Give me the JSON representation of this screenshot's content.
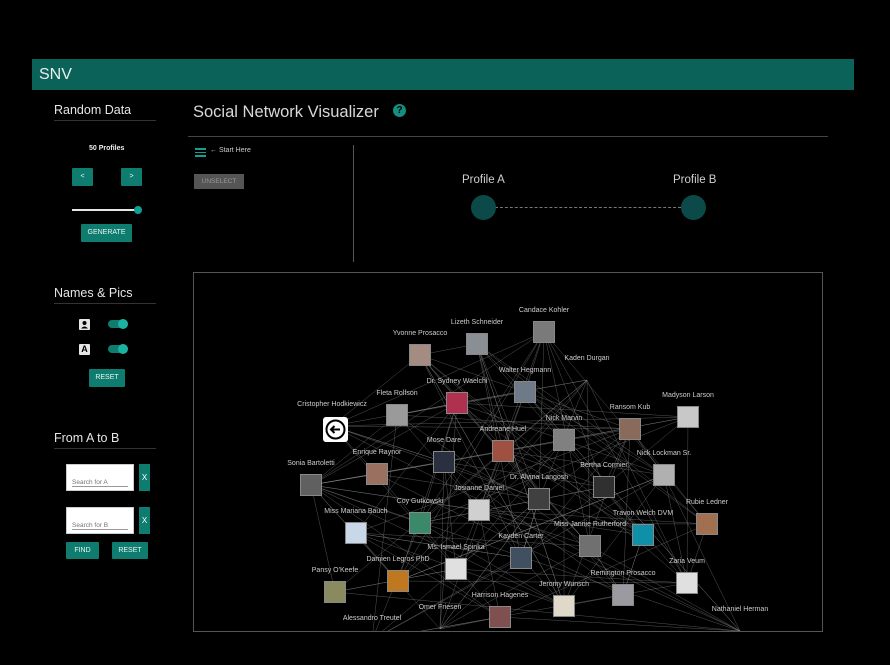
{
  "app": {
    "brand": "SNV"
  },
  "sidebar": {
    "random": {
      "title": "Random Data",
      "count_label": "50 Profiles",
      "prev_label": "<",
      "next_label": ">",
      "generate_label": "GENERATE",
      "profiles_slider_fraction": 1
    },
    "names_pics": {
      "title": "Names & Pics",
      "show_pics": true,
      "show_names": true,
      "names_icon_glyph": "A",
      "reset_label": "RESET"
    },
    "a_to_b": {
      "title": "From A to B",
      "search_a_placeholder": "Search for A",
      "search_b_placeholder": "Search for B",
      "clear_label": "X",
      "find_label": "FIND",
      "reset_label": "RESET"
    }
  },
  "main": {
    "title": "Social Network Visualizer",
    "help_glyph": "?",
    "start_here": "← Start Here",
    "unselect_label": "UNSELECT",
    "profile_a_label": "Profile A",
    "profile_b_label": "Profile B"
  },
  "graph": {
    "nodes": [
      {
        "name": "Candace Kohler",
        "img": "#7a7a7a"
      },
      {
        "name": "Lizeth Schneider",
        "img": "#8a8f96"
      },
      {
        "name": "Yvonne Prosacco",
        "img": "#a48c82"
      },
      {
        "name": "Kaden Durgan",
        "img": null
      },
      {
        "name": "Walter Hegmann",
        "img": "#6e7a88"
      },
      {
        "name": "Dr. Sydney Waelchi",
        "img": "#b03050"
      },
      {
        "name": "Fleta Rolfson",
        "img": "#9a9a9a"
      },
      {
        "name": "Madyson Larson",
        "img": "#c8c8c8"
      },
      {
        "name": "Cristopher Hodkiewicz",
        "img": null
      },
      {
        "name": "Ransom Kub",
        "img": "#8a6a5a"
      },
      {
        "name": "Nick Marvin",
        "img": "#808080"
      },
      {
        "name": "Andreane Huel",
        "img": "#a05040"
      },
      {
        "name": "Mose Dare",
        "img": "#2a3040"
      },
      {
        "name": "Enrique Raynor",
        "img": "#9a7060"
      },
      {
        "name": "Nick Lockman Sr.",
        "img": "#b0b0b0"
      },
      {
        "name": "Sonia Bartoletti",
        "img": "#606060"
      },
      {
        "name": "Bertha Cormier",
        "img": "#303030"
      },
      {
        "name": "Dr. Alvina Langosh",
        "img": "#404040"
      },
      {
        "name": "Josianne Daniel",
        "img": "#d0d0d0"
      },
      {
        "name": "Coy Gutkowski",
        "img": "#3a8a6a"
      },
      {
        "name": "Rubie Ledner",
        "img": "#a07050"
      },
      {
        "name": "Miss Mariana Bauch",
        "img": "#c8d8e8"
      },
      {
        "name": "Travon Welch DVM",
        "img": "#1090a8"
      },
      {
        "name": "Miss Jannie Rutherford",
        "img": "#707070"
      },
      {
        "name": "Kayden Carter",
        "img": "#405060"
      },
      {
        "name": "Ms. Ismael Spinka",
        "img": "#e0e0e0"
      },
      {
        "name": "Damien Legros PhD",
        "img": "#c07820"
      },
      {
        "name": "Zaria Veum",
        "img": "#e0e0e0"
      },
      {
        "name": "Pansy O'Keefe",
        "img": "#8a8a60"
      },
      {
        "name": "Remington Prosacco",
        "img": "#9a9aa0"
      },
      {
        "name": "Jeromy Wunsch",
        "img": "#e0d8c8"
      },
      {
        "name": "Harrison Hagenes",
        "img": "#805050"
      },
      {
        "name": "Nathaniel Herman",
        "img": null
      },
      {
        "name": "Omer Friesen",
        "img": null
      },
      {
        "name": "Alessandro Treutel",
        "img": null
      }
    ]
  }
}
